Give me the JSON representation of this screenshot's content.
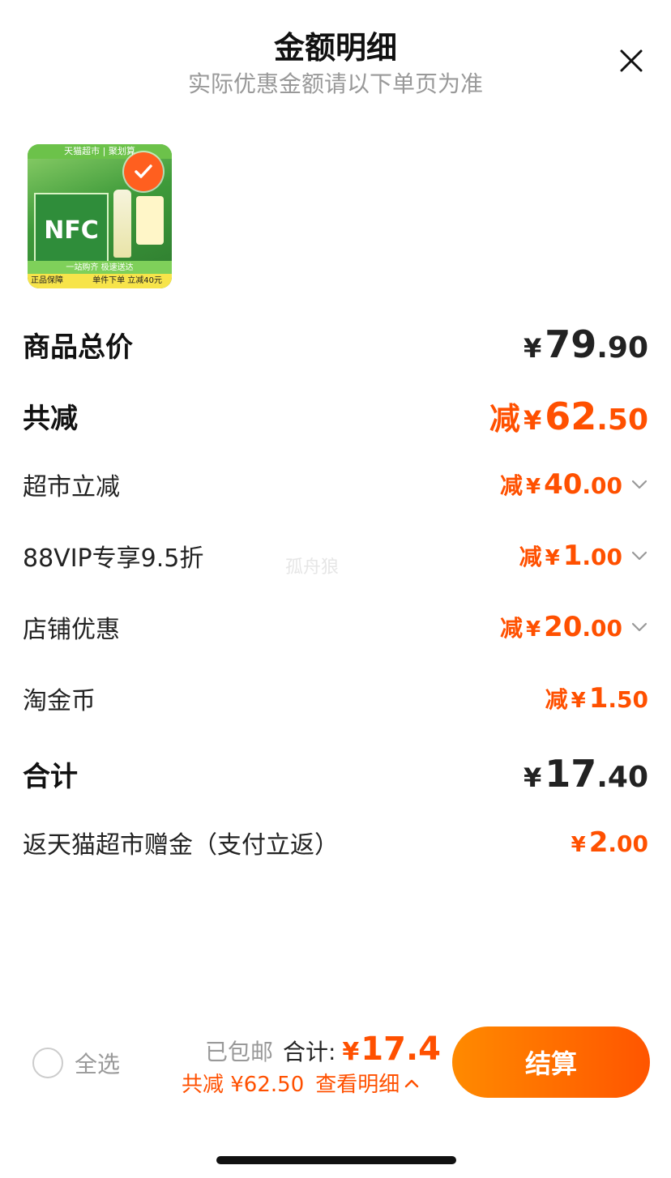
{
  "header": {
    "title": "金额明细",
    "subtitle": "实际优惠金额请以下单页为准"
  },
  "product": {
    "top_banner": "天猫超市 | 聚划算",
    "box_text": "NFC",
    "strip_text": "一站购齐 极速送达",
    "badge_left": "正品保障",
    "badge_right": "单件下单 立减40元"
  },
  "rows": [
    {
      "label": "商品总价",
      "prefix": "",
      "yen": "¥",
      "int": "79",
      "dec": ".90"
    },
    {
      "label": "共减",
      "prefix": "减",
      "yen": "¥",
      "int": "62",
      "dec": ".50"
    },
    {
      "label": "超市立减",
      "prefix": "减",
      "yen": "¥",
      "int": "40",
      "dec": ".00"
    },
    {
      "label": "88VIP专享9.5折",
      "prefix": "减",
      "yen": "¥",
      "int": "1",
      "dec": ".00"
    },
    {
      "label": "店铺优惠",
      "prefix": "减",
      "yen": "¥",
      "int": "20",
      "dec": ".00"
    },
    {
      "label": "淘金币",
      "prefix": "减",
      "yen": "¥",
      "int": "1",
      "dec": ".50"
    },
    {
      "label": "合计",
      "prefix": "",
      "yen": "¥",
      "int": "17",
      "dec": ".40"
    },
    {
      "label": "返天猫超市赠金（支付立返）",
      "prefix": "",
      "yen": "¥",
      "int": "2",
      "dec": ".00"
    }
  ],
  "watermark": "孤舟狼",
  "footer": {
    "select_all": "全选",
    "shipped": "已包邮",
    "total_label": "合计:",
    "total_yen": "¥",
    "total_value": "17.4",
    "discount_summary": "共减 ¥62.50",
    "view_details": "查看明细",
    "checkout": "结算"
  },
  "colors": {
    "accent": "#ff5000",
    "checkout_gradient_start": "#ff8a00",
    "checkout_gradient_end": "#ff5500"
  },
  "icons": {
    "close": "close-icon",
    "check": "check-icon",
    "chevron_down": "chevron-down-icon",
    "chevron_up": "chevron-up-icon"
  }
}
